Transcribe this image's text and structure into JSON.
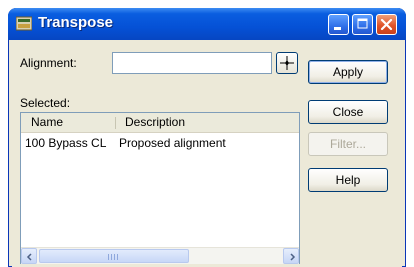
{
  "window": {
    "title": "Transpose",
    "colors": {
      "titlebar": "#0551d6",
      "close_button": "#e0542a",
      "body": "#ece9d8"
    }
  },
  "alignment": {
    "label": "Alignment:",
    "value": "",
    "pick_icon": "crosshair-icon"
  },
  "selected": {
    "label": "Selected:",
    "columns": [
      "Name",
      "Description"
    ],
    "rows": [
      {
        "name": "100 Bypass CL",
        "description": "Proposed alignment"
      }
    ]
  },
  "buttons": {
    "apply": "Apply",
    "close": "Close",
    "filter": "Filter...",
    "help": "Help"
  }
}
